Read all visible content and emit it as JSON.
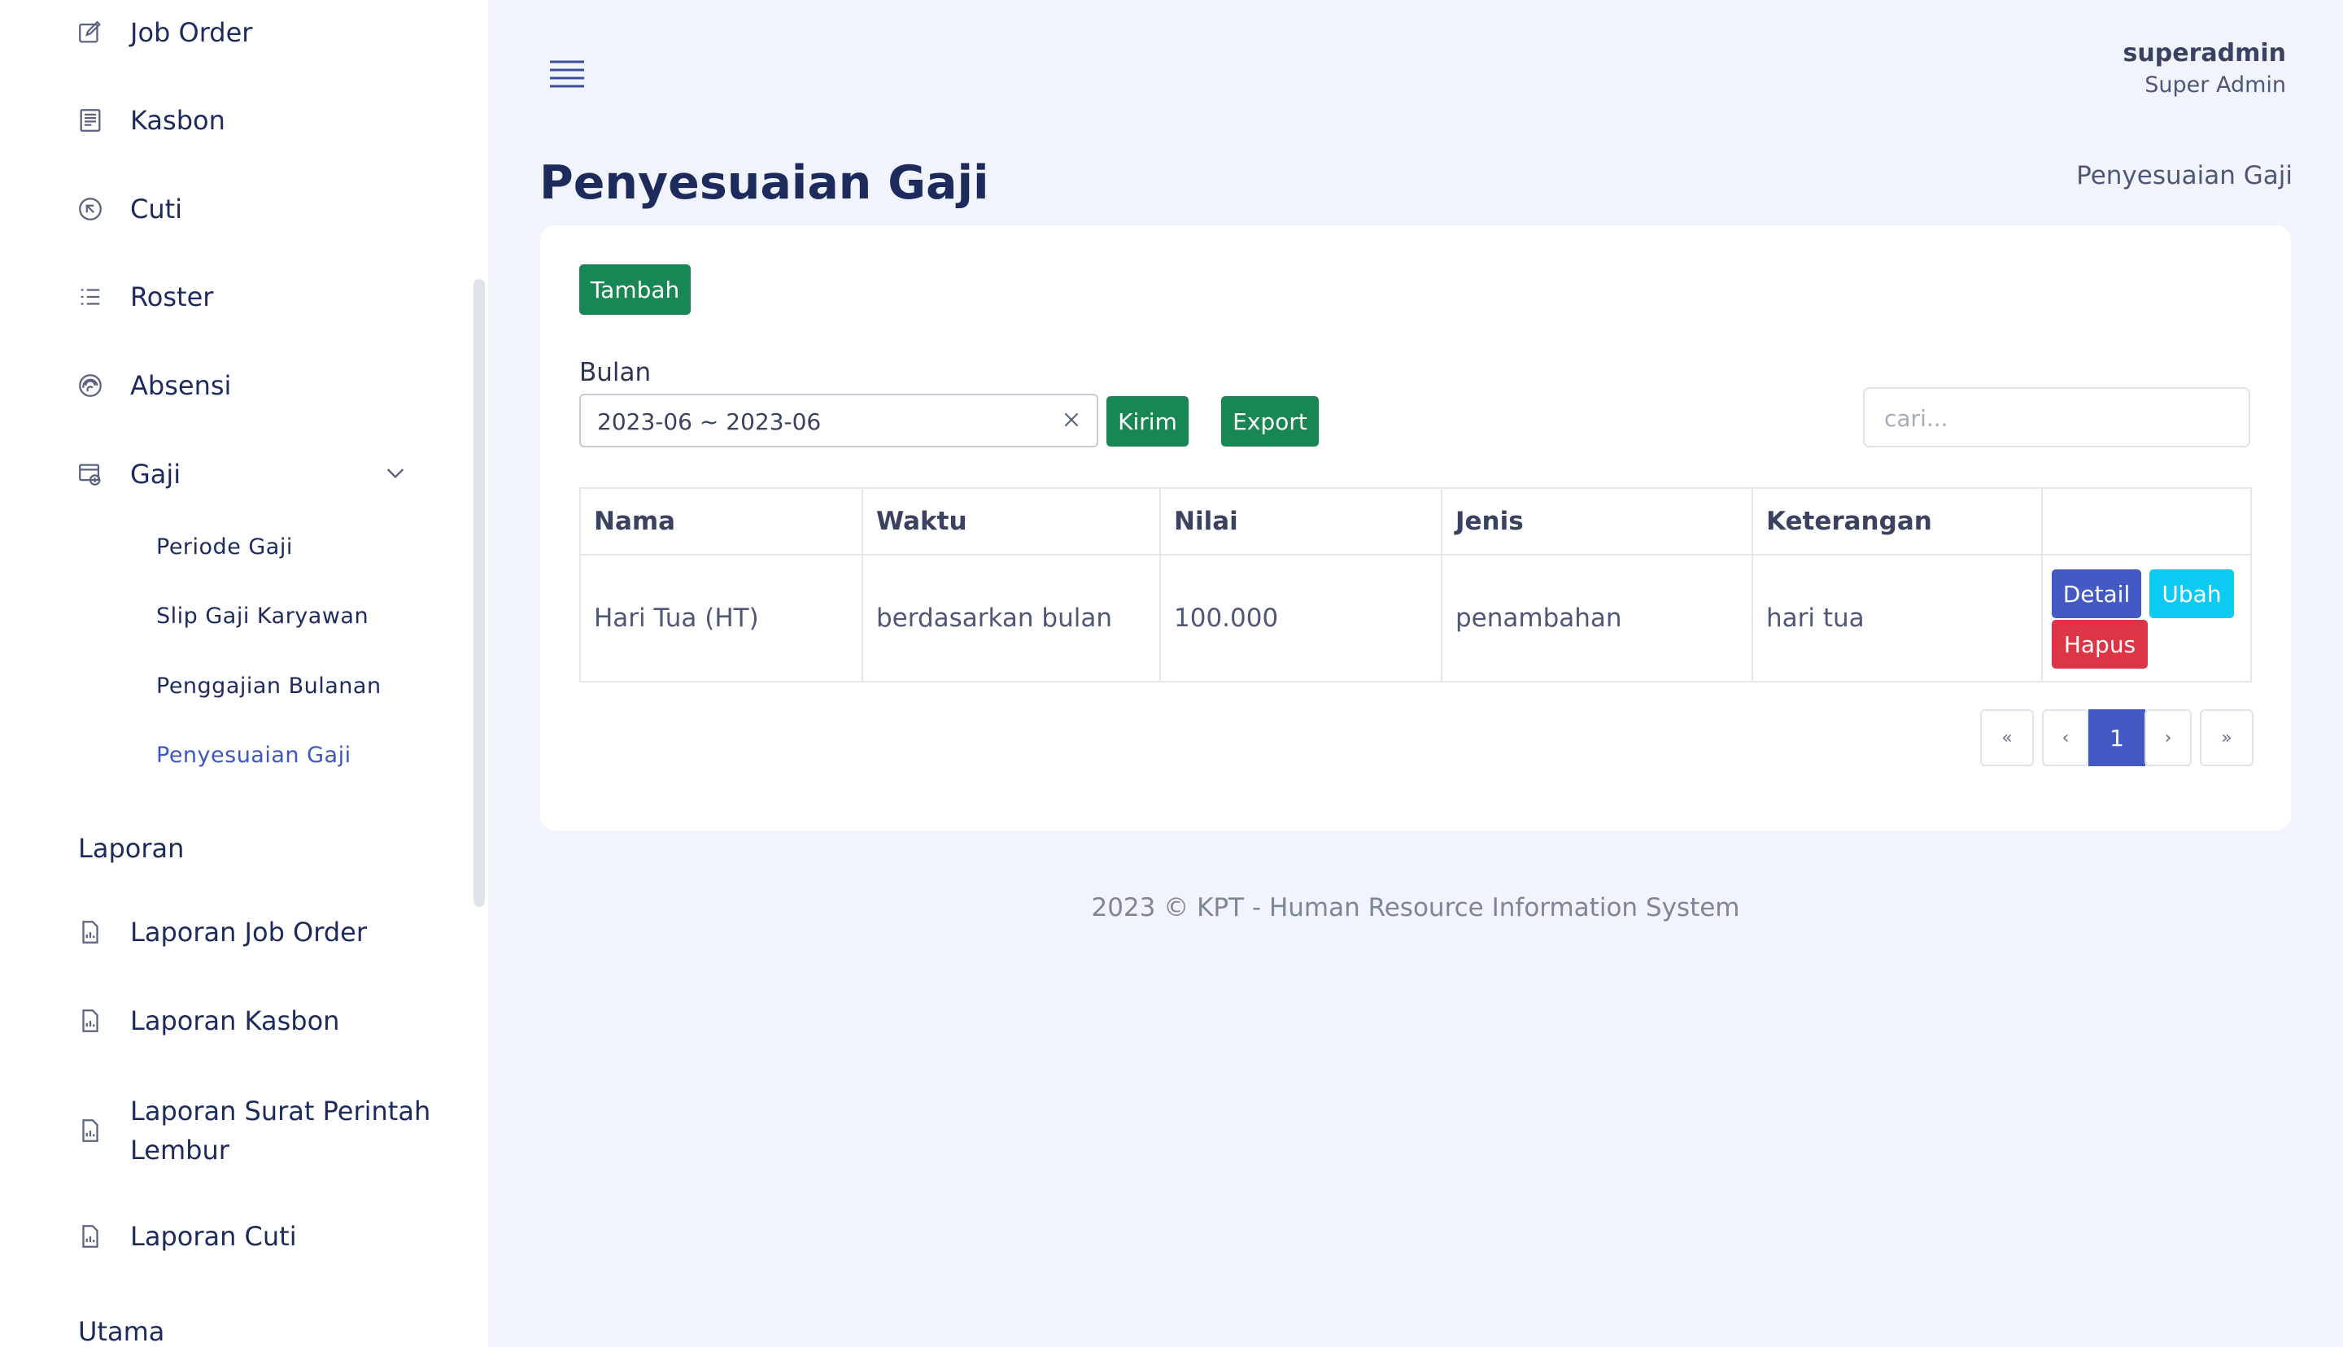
{
  "sidebar": {
    "items": [
      {
        "label": "Job Order",
        "icon": "pencil-square-icon"
      },
      {
        "label": "Kasbon",
        "icon": "receipt-icon"
      },
      {
        "label": "Cuti",
        "icon": "arrow-up-left-circle-icon"
      },
      {
        "label": "Roster",
        "icon": "list-icon"
      },
      {
        "label": "Absensi",
        "icon": "fingerprint-icon"
      },
      {
        "label": "Gaji",
        "icon": "cash-window-icon"
      }
    ],
    "gaji_sub": [
      {
        "label": "Periode Gaji"
      },
      {
        "label": "Slip Gaji Karyawan"
      },
      {
        "label": "Penggajian Bulanan"
      },
      {
        "label": "Penyesuaian Gaji"
      }
    ],
    "section_laporan": "Laporan",
    "laporan_items": [
      {
        "label": "Laporan Job Order"
      },
      {
        "label": "Laporan Kasbon"
      },
      {
        "label": "Laporan Surat Perintah Lembur"
      },
      {
        "label": "Laporan Cuti"
      }
    ],
    "section_utama": "Utama"
  },
  "header": {
    "user_name": "superadmin",
    "user_role": "Super Admin"
  },
  "page": {
    "title": "Penyesuaian Gaji",
    "breadcrumb": "Penyesuaian Gaji"
  },
  "toolbar": {
    "add_label": "Tambah",
    "month_label": "Bulan",
    "month_value": "2023-06 ~ 2023-06",
    "send_label": "Kirim",
    "export_label": "Export",
    "search_placeholder": "cari..."
  },
  "table": {
    "columns": [
      "Nama",
      "Waktu",
      "Nilai",
      "Jenis",
      "Keterangan",
      ""
    ],
    "rows": [
      {
        "nama": "Hari Tua (HT)",
        "waktu": "berdasarkan bulan",
        "nilai": "100.000",
        "jenis": "penambahan",
        "keterangan": "hari tua"
      }
    ],
    "actions": {
      "detail": "Detail",
      "ubah": "Ubah",
      "hapus": "Hapus"
    }
  },
  "pagination": {
    "first": "«",
    "prev": "‹",
    "current": "1",
    "next": "›",
    "last": "»"
  },
  "footer": "2023 © KPT - Human Resource Information System",
  "colors": {
    "accent": "#4359c4",
    "green": "#198754",
    "cyan": "#0dcaf0",
    "red": "#dc3545",
    "sidebar_text": "#1d2a5c"
  }
}
